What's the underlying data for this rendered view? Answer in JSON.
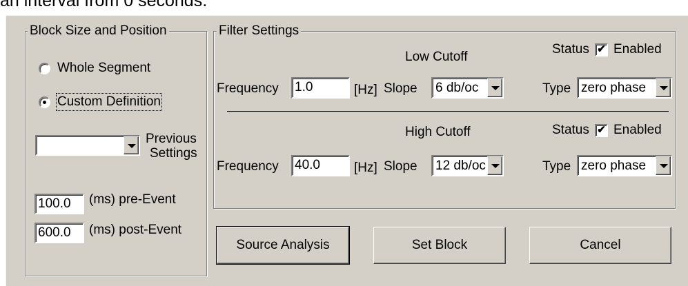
{
  "caption_text": "an interval from 0 seconds.",
  "block_group": {
    "title": "Block Size and Position",
    "radio_whole": "Whole Segment",
    "radio_custom": "Custom Definition",
    "custom_selected": true,
    "previous_settings_label_1": "Previous",
    "previous_settings_label_2": "Settings",
    "previous_settings_value": "",
    "pre_event_value": "100.0",
    "pre_event_label": "(ms) pre-Event",
    "post_event_value": "600.0",
    "post_event_label": "(ms) post-Event"
  },
  "filter_group": {
    "title": "Filter Settings",
    "low": {
      "heading": "Low Cutoff",
      "status_label": "Status",
      "enabled_label": "Enabled",
      "enabled": true,
      "frequency_label": "Frequency",
      "frequency_value": "1.0",
      "unit": "[Hz]",
      "slope_label": "Slope",
      "slope_value": "6 db/oc",
      "type_label": "Type",
      "type_value": "zero phase"
    },
    "high": {
      "heading": "High Cutoff",
      "status_label": "Status",
      "enabled_label": "Enabled",
      "enabled": true,
      "frequency_label": "Frequency",
      "frequency_value": "40.0",
      "unit": "[Hz]",
      "slope_label": "Slope",
      "slope_value": "12 db/oc",
      "type_label": "Type",
      "type_value": "zero phase"
    }
  },
  "buttons": {
    "source_analysis": "Source Analysis",
    "set_block": "Set Block",
    "cancel": "Cancel"
  },
  "check_mark": "✔"
}
